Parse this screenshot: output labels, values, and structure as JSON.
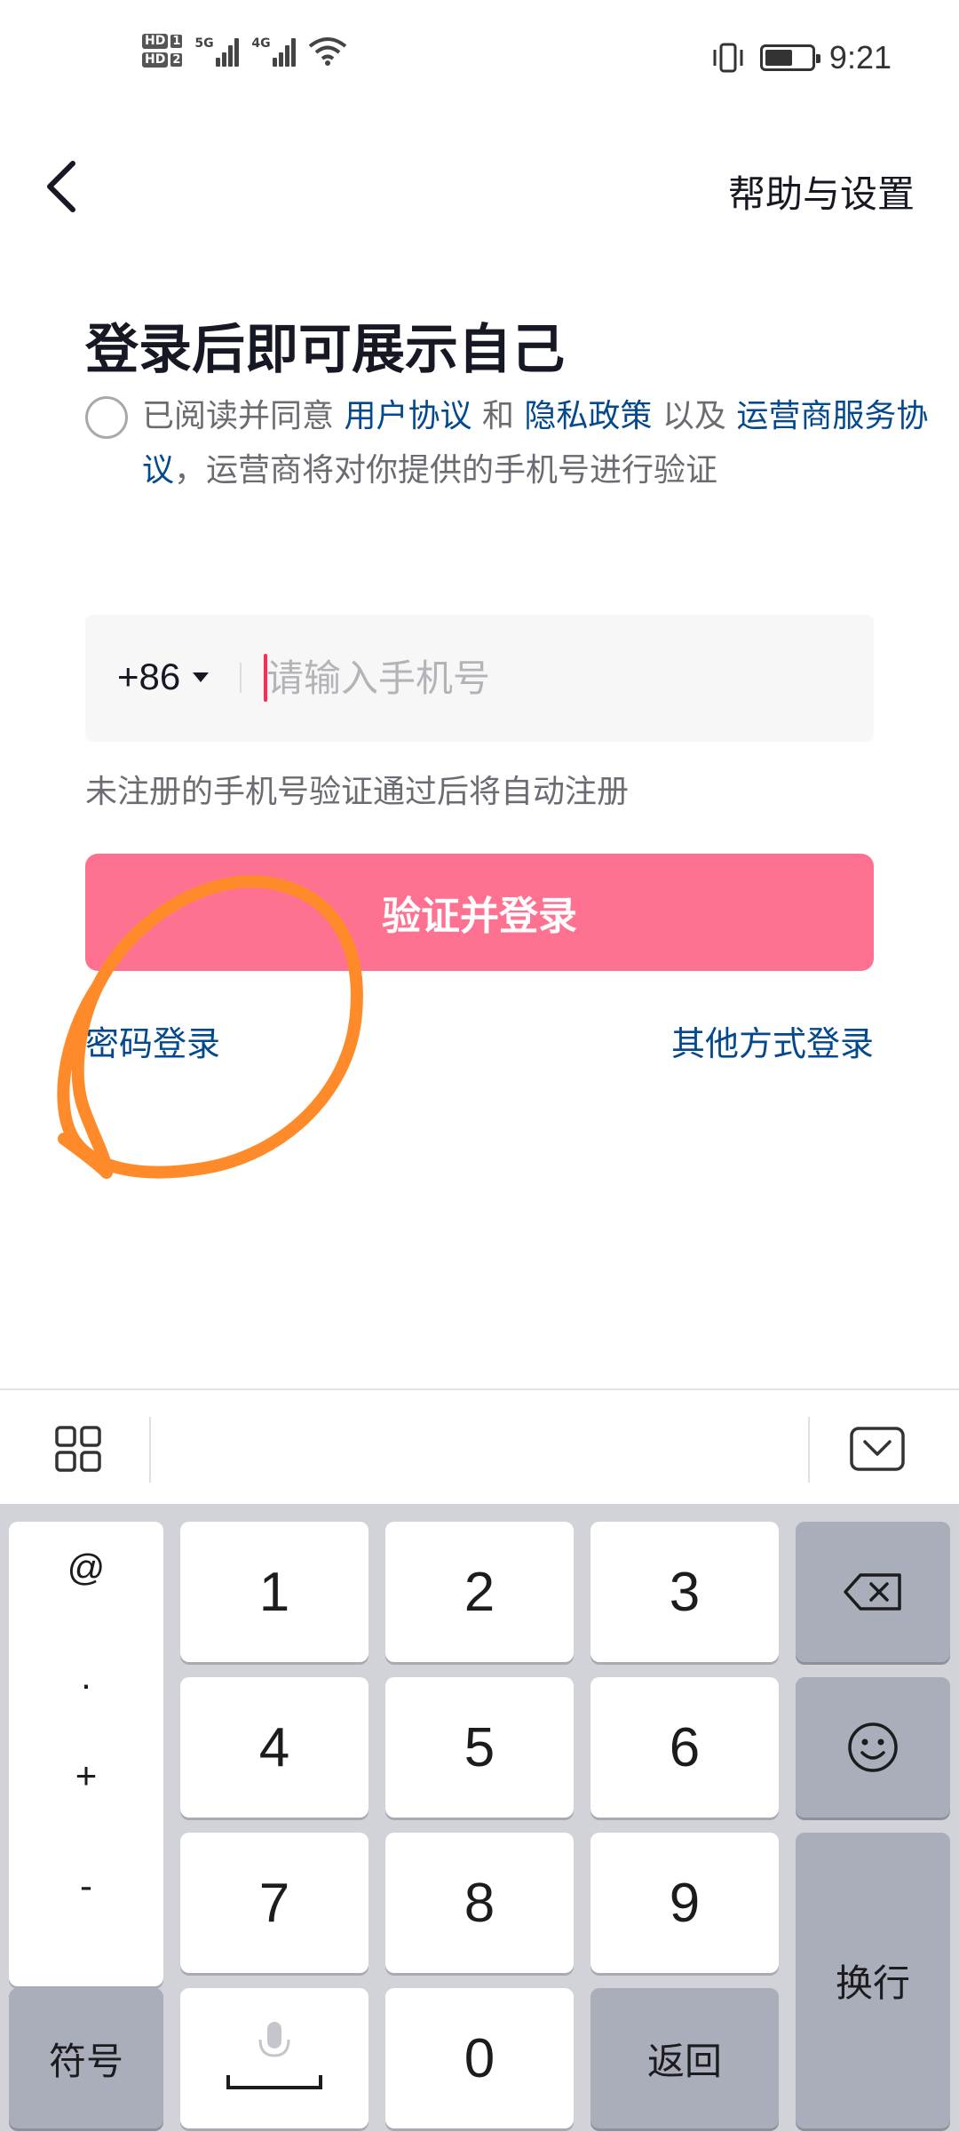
{
  "status_bar": {
    "hd1": "HD",
    "hd1_num": "1",
    "hd2": "HD",
    "hd2_num": "2",
    "net1": "5G",
    "net2": "4G",
    "time": "9:21",
    "battery_level": 0.6,
    "icons": [
      "signal-icon",
      "wifi-icon",
      "vibrate-icon",
      "battery-icon"
    ]
  },
  "nav": {
    "back_icon": "chevron-left-icon",
    "help_label": "帮助与设置"
  },
  "login": {
    "title": "登录后即可展示自己",
    "agreement": {
      "prefix": "已阅读并同意",
      "user_agreement": "用户协议",
      "and": "和",
      "privacy_policy": "隐私政策",
      "also": "以及",
      "carrier_agreement": "运营商服务协议",
      "suffix": "，运营商将对你提供的手机号进行验证"
    },
    "country_code": "+86",
    "phone_placeholder": "请输入手机号",
    "auto_register_hint": "未注册的手机号验证通过后将自动注册",
    "submit_label": "验证并登录",
    "password_login": "密码登录",
    "other_login": "其他方式登录"
  },
  "colors": {
    "primary_button": "#ff7190",
    "link": "#04498d",
    "cursor": "#fe2c55",
    "annotation": "#ff8a2a"
  },
  "keyboard": {
    "toolbar_icons": [
      "grid-menu-icon",
      "keyboard-hide-icon"
    ],
    "symbols": [
      "@",
      ".",
      "+",
      "-"
    ],
    "digits": [
      "1",
      "2",
      "3",
      "4",
      "5",
      "6",
      "7",
      "8",
      "9",
      "0"
    ],
    "symbol_key": "符号",
    "return_key": "返回",
    "newline_key": "换行",
    "icons": [
      "backspace-icon",
      "emoji-icon",
      "microphone-icon"
    ]
  }
}
